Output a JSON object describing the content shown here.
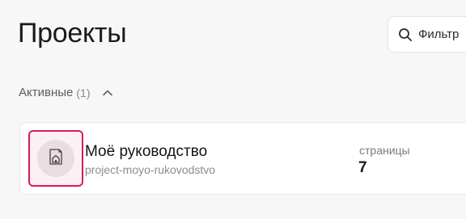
{
  "header": {
    "title": "Проекты",
    "filter": {
      "placeholder": "Фильтр",
      "icon": "search-icon"
    }
  },
  "section": {
    "label": "Активные",
    "count": "(1)",
    "icon": "chevron-up-icon"
  },
  "projects": [
    {
      "name": "Моё руководство",
      "slug": "project-moyo-rukovodstvo",
      "pages_label": "страницы",
      "pages_count": "7",
      "icon": "docs-house-icon"
    }
  ],
  "colors": {
    "accent": "#d81b60",
    "background": "#f7f7f8",
    "card": "#ffffff"
  }
}
